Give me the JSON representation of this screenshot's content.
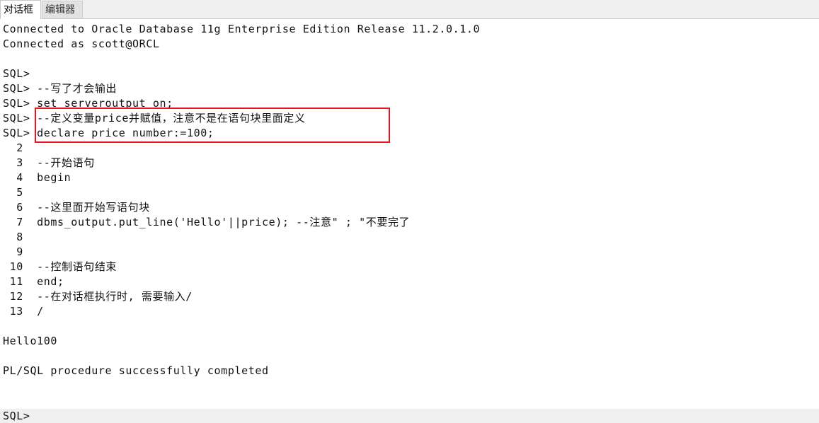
{
  "tabs": [
    {
      "label": "对话框"
    },
    {
      "label": "编辑器"
    }
  ],
  "output_lines": [
    "Connected to Oracle Database 11g Enterprise Edition Release 11.2.0.1.0",
    "Connected as scott@ORCL",
    "",
    "SQL>",
    "SQL> --写了才会输出",
    "SQL> set serveroutput on;",
    "SQL> --定义变量price并赋值，注意不是在语句块里面定义",
    "SQL> declare price number:=100;",
    "  2",
    "  3  --开始语句",
    "  4  begin",
    "  5",
    "  6  --这里面开始写语句块",
    "  7  dbms_output.put_line('Hello'||price); --注意\" ; \"不要完了",
    "  8",
    "  9",
    " 10  --控制语句结束",
    " 11  end;",
    " 12  --在对话框执行时, 需要输入/",
    " 13  /",
    "",
    "Hello100",
    "",
    "PL/SQL procedure successfully completed",
    "",
    ""
  ],
  "prompt": {
    "text": "SQL>"
  },
  "colors": {
    "highlight_border": "#e8131c",
    "tab_bar_bg": "#f0f0f0",
    "prompt_bar_bg": "#f0f0f0"
  }
}
